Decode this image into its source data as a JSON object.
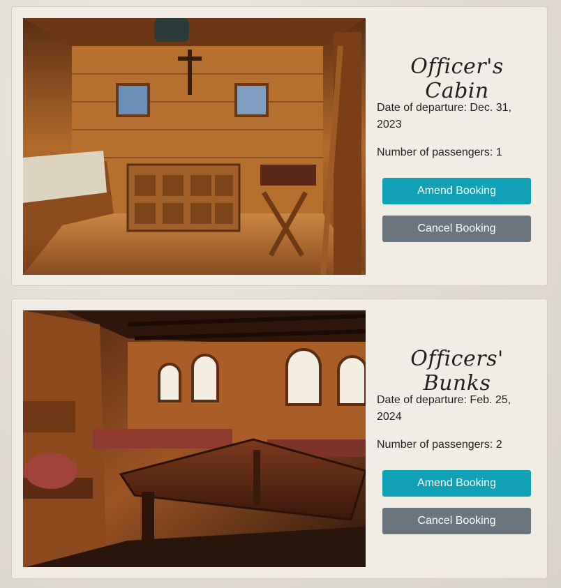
{
  "bookings": [
    {
      "title": "Officer's Cabin",
      "departure": "Date of departure: Dec. 31, 2023",
      "passengers": "Number of passengers: 1",
      "amend_label": "Amend Booking",
      "cancel_label": "Cancel Booking"
    },
    {
      "title": "Officers' Bunks",
      "departure": "Date of departure: Feb. 25, 2024",
      "passengers": "Number of passengers: 2",
      "amend_label": "Amend Booking",
      "cancel_label": "Cancel Booking"
    }
  ],
  "colors": {
    "amend": "#11a1b6",
    "cancel": "#6b757d"
  }
}
